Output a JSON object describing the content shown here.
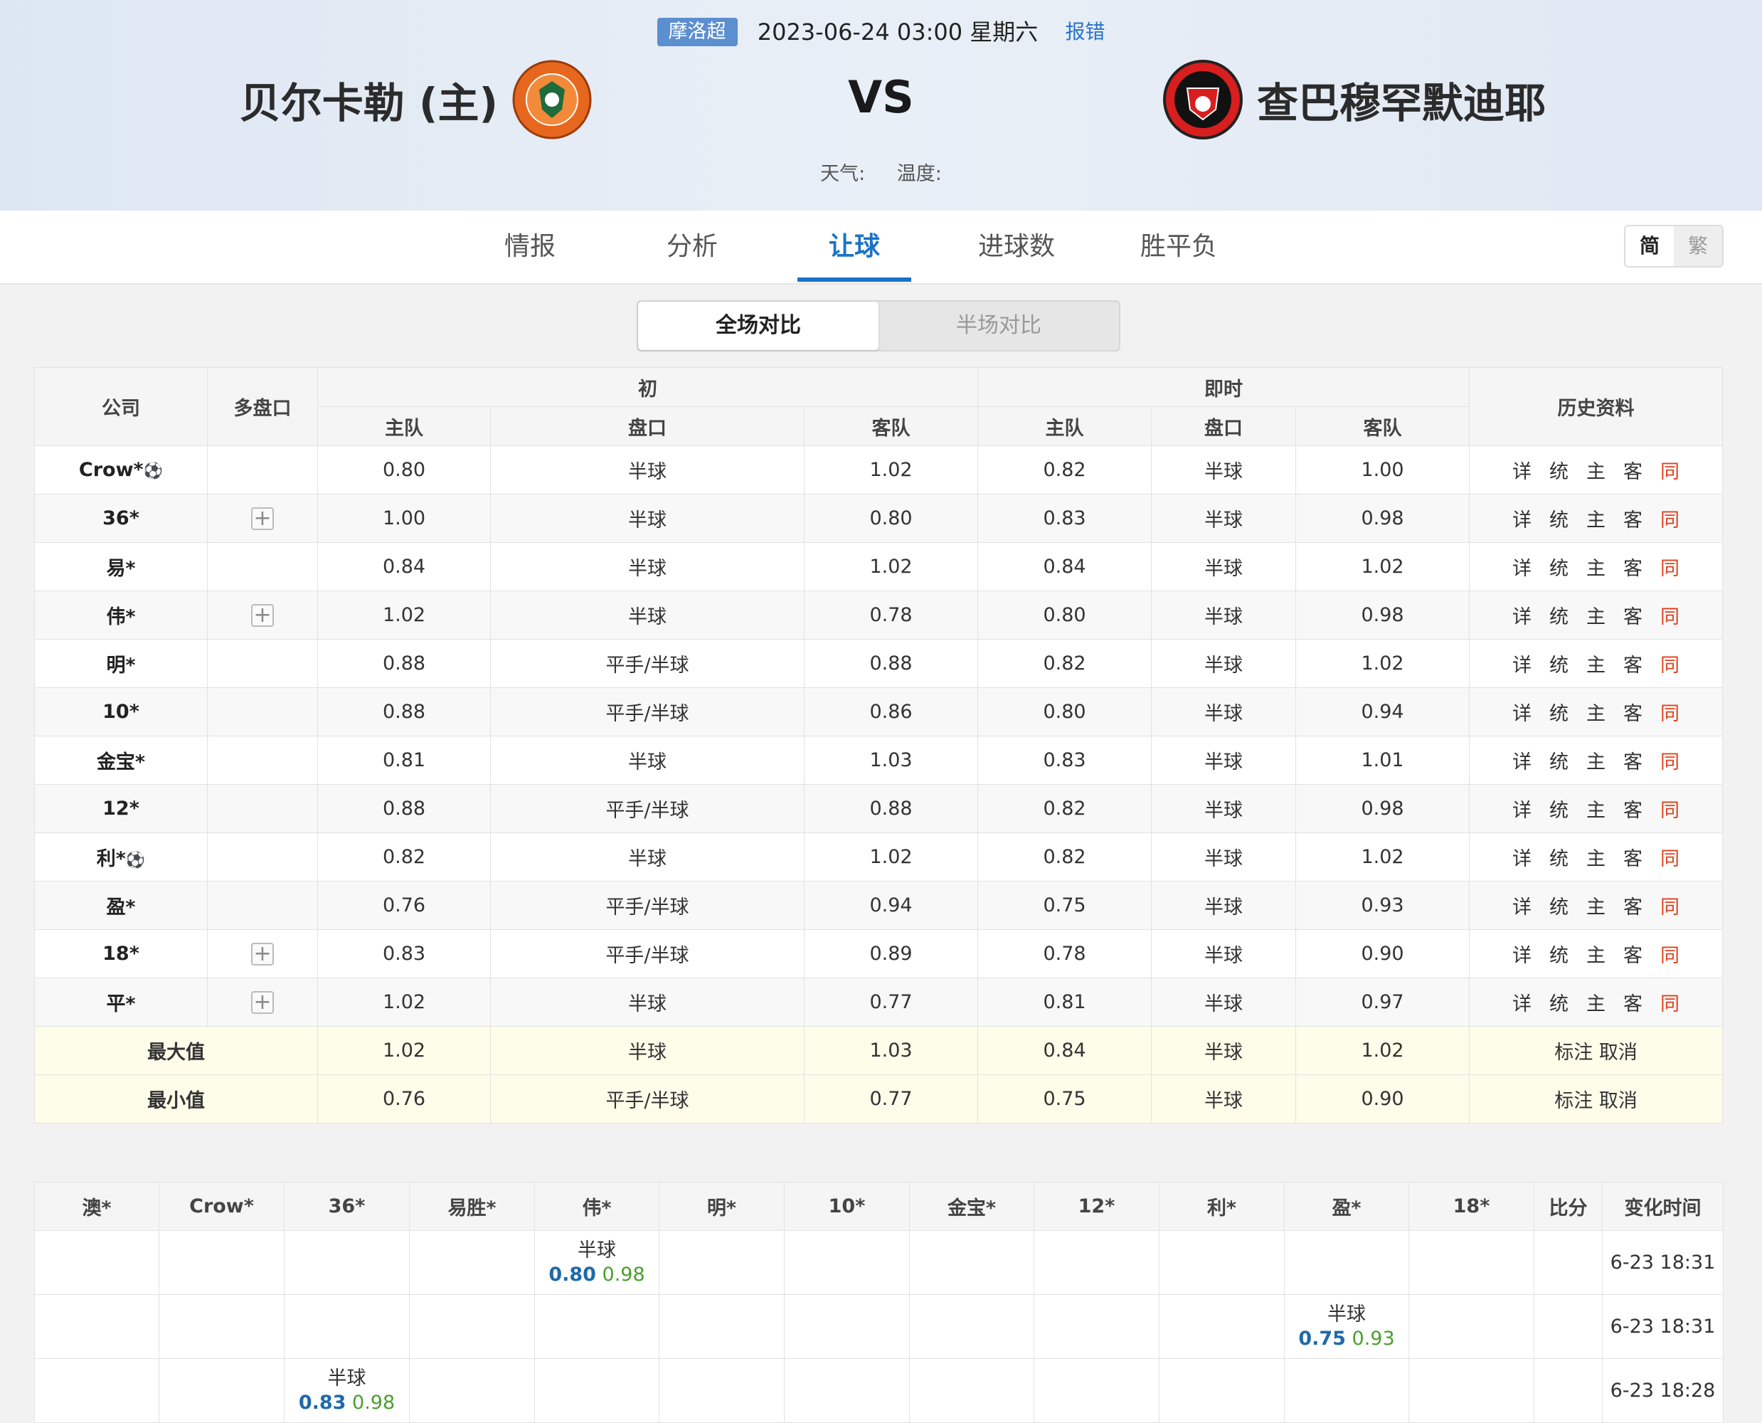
{
  "match": {
    "league": "摩洛超",
    "datetime": "2023-06-24 03:00 星期六",
    "report": "报错",
    "home_name": "贝尔卡勒 (主)",
    "away_name": "查巴穆罕默迪耶",
    "vs": "VS",
    "weather_label": "天气:",
    "temp_label": "温度:"
  },
  "tabs": [
    "情报",
    "分析",
    "让球",
    "进球数",
    "胜平负"
  ],
  "active_tab": "让球",
  "lang": {
    "simplified": "简",
    "traditional": "繁"
  },
  "segment": {
    "full": "全场对比",
    "half": "半场对比"
  },
  "odds_table": {
    "headers": {
      "company": "公司",
      "multi": "多盘口",
      "initial": "初",
      "live": "即时",
      "history": "历史资料",
      "home": "主队",
      "line": "盘口",
      "away": "客队"
    },
    "history_links": [
      "详",
      "统",
      "主",
      "客",
      "同"
    ],
    "rows": [
      {
        "company": "Crow*",
        "ball": true,
        "plus": false,
        "ih": "0.80",
        "il": "半球",
        "ia": "1.02",
        "lh": "0.82",
        "ll": "半球",
        "la": "1.00"
      },
      {
        "company": "36*",
        "ball": false,
        "plus": true,
        "ih": "1.00",
        "il": "半球",
        "ia": "0.80",
        "lh": "0.83",
        "ll": "半球",
        "la": "0.98"
      },
      {
        "company": "易*",
        "ball": false,
        "plus": false,
        "ih": "0.84",
        "il": "半球",
        "ia": "1.02",
        "lh": "0.84",
        "ll": "半球",
        "la": "1.02"
      },
      {
        "company": "伟*",
        "ball": false,
        "plus": true,
        "ih": "1.02",
        "il": "半球",
        "ia": "0.78",
        "lh": "0.80",
        "ll": "半球",
        "la": "0.98"
      },
      {
        "company": "明*",
        "ball": false,
        "plus": false,
        "ih": "0.88",
        "il": "平手/半球",
        "ia": "0.88",
        "lh": "0.82",
        "ll": "半球",
        "la": "1.02"
      },
      {
        "company": "10*",
        "ball": false,
        "plus": false,
        "ih": "0.88",
        "il": "平手/半球",
        "ia": "0.86",
        "lh": "0.80",
        "ll": "半球",
        "la": "0.94"
      },
      {
        "company": "金宝*",
        "ball": false,
        "plus": false,
        "ih": "0.81",
        "il": "半球",
        "ia": "1.03",
        "lh": "0.83",
        "ll": "半球",
        "la": "1.01"
      },
      {
        "company": "12*",
        "ball": false,
        "plus": false,
        "ih": "0.88",
        "il": "平手/半球",
        "ia": "0.88",
        "lh": "0.82",
        "ll": "半球",
        "la": "0.98"
      },
      {
        "company": "利*",
        "ball": true,
        "plus": false,
        "ih": "0.82",
        "il": "半球",
        "ia": "1.02",
        "lh": "0.82",
        "ll": "半球",
        "la": "1.02"
      },
      {
        "company": "盈*",
        "ball": false,
        "plus": false,
        "ih": "0.76",
        "il": "平手/半球",
        "ia": "0.94",
        "lh": "0.75",
        "ll": "半球",
        "la": "0.93"
      },
      {
        "company": "18*",
        "ball": false,
        "plus": true,
        "ih": "0.83",
        "il": "平手/半球",
        "ia": "0.89",
        "lh": "0.78",
        "ll": "半球",
        "la": "0.90"
      },
      {
        "company": "平*",
        "ball": false,
        "plus": true,
        "ih": "1.02",
        "il": "半球",
        "ia": "0.77",
        "lh": "0.81",
        "ll": "半球",
        "la": "0.97"
      }
    ],
    "stats": [
      {
        "label": "最大值",
        "ih": "1.02",
        "il": "半球",
        "ia": "1.03",
        "lh": "0.84",
        "ll": "半球",
        "la": "1.02",
        "mark": "标注",
        "cancel": "取消"
      },
      {
        "label": "最小值",
        "ih": "0.76",
        "il": "平手/半球",
        "ia": "0.77",
        "lh": "0.75",
        "ll": "半球",
        "la": "0.90",
        "mark": "标注",
        "cancel": "取消"
      }
    ]
  },
  "change_table": {
    "headers": [
      "澳*",
      "Crow*",
      "36*",
      "易胜*",
      "伟*",
      "明*",
      "10*",
      "金宝*",
      "12*",
      "利*",
      "盈*",
      "18*",
      "比分",
      "变化时间"
    ],
    "rows": [
      {
        "col": 4,
        "line": "半球",
        "home": "0.80",
        "away": "0.98",
        "time": "6-23 18:31"
      },
      {
        "col": 10,
        "line": "半球",
        "home": "0.75",
        "away": "0.93",
        "time": "6-23 18:31"
      },
      {
        "col": 2,
        "line": "半球",
        "home": "0.83",
        "away": "0.98",
        "time": "6-23 18:28"
      }
    ]
  },
  "colors": {
    "accent": "#1a73c9",
    "league_badge": "#5b8fcf",
    "same_link": "#e0401c",
    "change_home": "#1e6aa9",
    "change_away": "#4a9e2e"
  }
}
